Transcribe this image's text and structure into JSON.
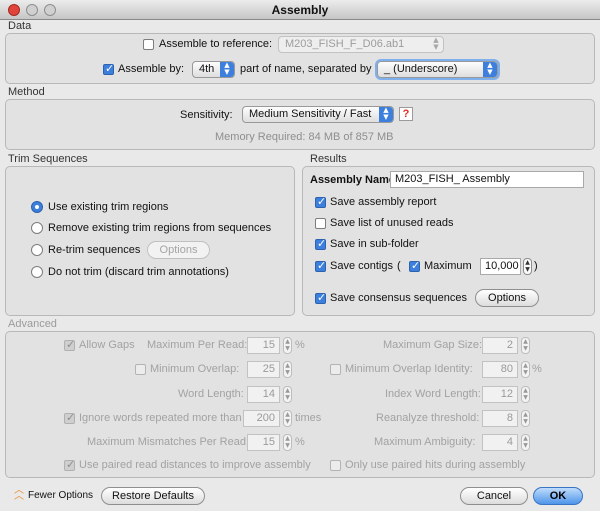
{
  "window": {
    "title": "Assembly"
  },
  "data_section": {
    "label": "Data",
    "assemble_to_reference": {
      "label": "Assemble to reference:",
      "checked": false,
      "value": "M203_FISH_F_D06.ab1"
    },
    "assemble_by": {
      "label": "Assemble by:",
      "checked": true,
      "part_value": "4th",
      "mid_text": "part of name, separated by",
      "separator_value": "_ (Underscore)"
    }
  },
  "method_section": {
    "label": "Method",
    "sensitivity_label": "Sensitivity:",
    "sensitivity_value": "Medium Sensitivity / Fast",
    "help_glyph": "?",
    "memory_text": "Memory Required: 84 MB of 857 MB"
  },
  "trim_section": {
    "label": "Trim Sequences",
    "options": [
      {
        "label": "Use existing trim regions",
        "selected": true
      },
      {
        "label": "Remove existing trim regions from sequences",
        "selected": false
      },
      {
        "label": "Re-trim sequences",
        "selected": false
      },
      {
        "label": "Do not trim (discard trim annotations)",
        "selected": false
      }
    ],
    "options_button": "Options"
  },
  "results_section": {
    "label": "Results",
    "assembly_name_label": "Assembly Name",
    "assembly_name_value": "M203_FISH_ Assembly",
    "save_assembly_report": {
      "label": "Save assembly report",
      "checked": true
    },
    "save_unused_reads": {
      "label": "Save list of unused reads",
      "checked": false
    },
    "save_subfolder": {
      "label": "Save in sub-folder",
      "checked": true
    },
    "save_contigs": {
      "label": "Save contigs",
      "checked": true
    },
    "paren_open": "(",
    "paren_close": ")",
    "maximum": {
      "label": "Maximum",
      "checked": true,
      "value": "10,000"
    },
    "save_consensus": {
      "label": "Save consensus sequences",
      "checked": true
    },
    "options_button": "Options"
  },
  "advanced_section": {
    "label": "Advanced",
    "allow_gaps": {
      "label": "Allow Gaps",
      "checked": true
    },
    "max_per_read": {
      "label": "Maximum Per Read:",
      "value": "15",
      "unit": "%"
    },
    "max_gap_size": {
      "label": "Maximum Gap Size:",
      "value": "2"
    },
    "min_overlap": {
      "label": "Minimum Overlap:",
      "checked": false,
      "value": "25"
    },
    "min_overlap_identity": {
      "label": "Minimum Overlap Identity:",
      "checked": false,
      "value": "80",
      "unit": "%"
    },
    "word_length": {
      "label": "Word Length:",
      "value": "14"
    },
    "index_word_length": {
      "label": "Index Word Length:",
      "value": "12"
    },
    "ignore_words": {
      "label": "Ignore words repeated more than",
      "checked": true,
      "value": "200",
      "unit": "times"
    },
    "reanalyze_threshold": {
      "label": "Reanalyze threshold:",
      "value": "8"
    },
    "max_mismatches": {
      "label": "Maximum Mismatches Per Read:",
      "value": "15",
      "unit": "%"
    },
    "max_ambiguity": {
      "label": "Maximum Ambiguity:",
      "value": "4"
    },
    "paired_distances": {
      "label": "Use paired read distances to improve assembly",
      "checked": true
    },
    "paired_hits": {
      "label": "Only use paired hits during assembly",
      "checked": false
    }
  },
  "footer": {
    "fewer_options": "Fewer Options",
    "restore_defaults": "Restore Defaults",
    "cancel": "Cancel",
    "ok": "OK"
  },
  "colors": {
    "accent": "#3c7fdc",
    "help": "#e0301e",
    "fewer_options_icon": "#e8872a"
  },
  "icons": {
    "fewer_options_icon": "double-chevron-up-icon",
    "close_window": "close-icon"
  }
}
